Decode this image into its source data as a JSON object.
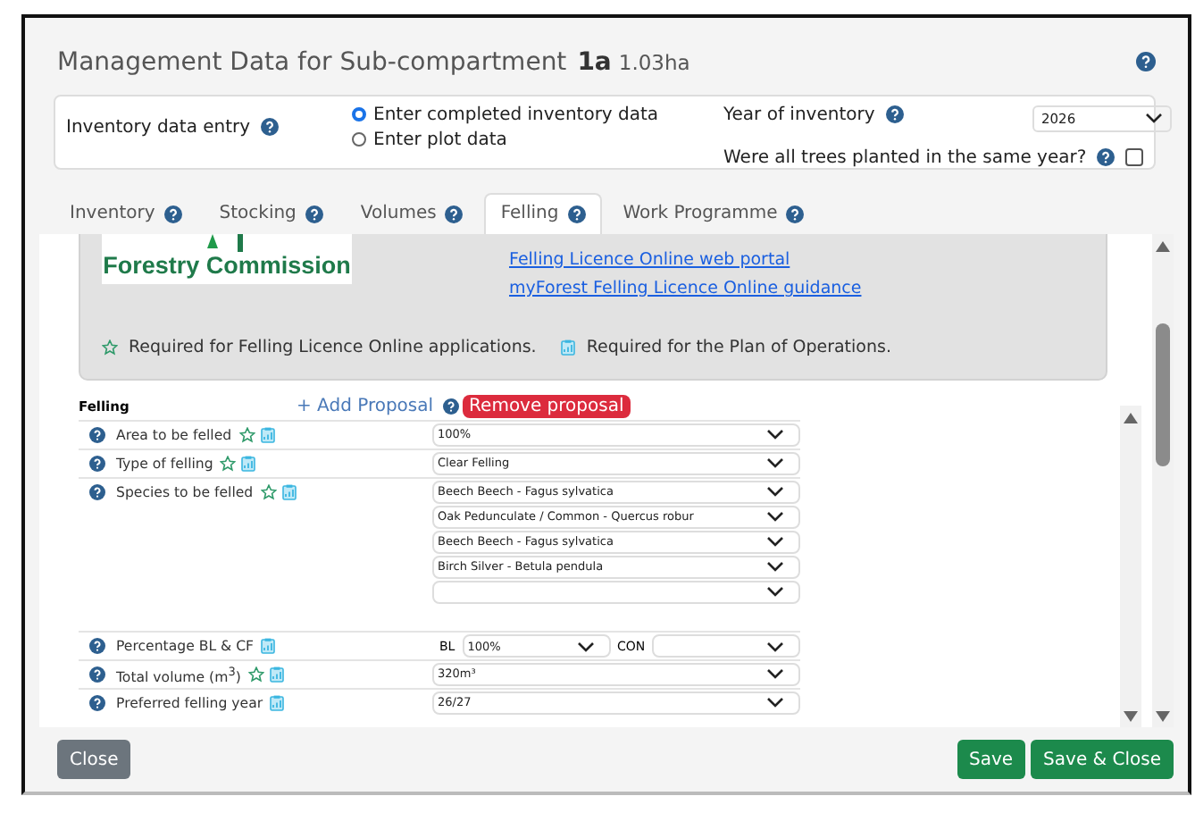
{
  "dialog": {
    "title": "Management Data for Sub-compartment",
    "subcompartment": "1a",
    "area": "1.03ha"
  },
  "inventory": {
    "label": "Inventory data entry",
    "options": [
      {
        "label": "Enter completed inventory data",
        "selected": true
      },
      {
        "label": "Enter plot data",
        "selected": false
      }
    ],
    "year_label": "Year of inventory",
    "year": "2026",
    "same_year_label": "Were all trees planted in the same year?",
    "same_year_checked": false
  },
  "tabs": [
    {
      "label": "Inventory",
      "selected": false
    },
    {
      "label": "Stocking",
      "selected": false
    },
    {
      "label": "Volumes",
      "selected": false
    },
    {
      "label": "Felling",
      "selected": true
    },
    {
      "label": "Work Programme",
      "selected": false
    }
  ],
  "info": {
    "logo_text": "Forestry Commission",
    "links": [
      "Felling Licence Online web portal",
      "myForest Felling Licence Online guidance"
    ],
    "legend_star": "Required for Felling Licence Online applications.",
    "legend_plan": "Required for the Plan of Operations."
  },
  "felling": {
    "heading": "Felling",
    "add_proposal": "+ Add Proposal",
    "remove_proposal": "Remove proposal",
    "rows": [
      {
        "kind": "select",
        "label": "Area to be felled",
        "star": true,
        "values": [
          "100%"
        ]
      },
      {
        "kind": "select",
        "label": "Type of felling",
        "star": true,
        "values": [
          "Clear Felling"
        ]
      },
      {
        "kind": "select",
        "label": "Species to be felled",
        "star": true,
        "values": [
          "Beech Beech - Fagus sylvatica",
          "Oak Pedunculate / Common - Quercus robur",
          "Beech Beech - Fagus sylvatica",
          "Birch Silver - Betula pendula"
        ],
        "blank_select": true
      },
      {
        "kind": "split",
        "label": "Percentage BL & CF",
        "star": false,
        "bl_label": "BL",
        "bl_value": "100%",
        "con_label": "CON"
      },
      {
        "kind": "select",
        "label": "Total volume (m$^{3}$)",
        "star": true,
        "values": [
          "320m³"
        ]
      },
      {
        "kind": "select",
        "label": "Preferred felling year",
        "star": false,
        "values": [
          "26/27"
        ]
      }
    ]
  },
  "footer": {
    "close": "Close",
    "save": "Save",
    "save_close": "Save & Close"
  }
}
